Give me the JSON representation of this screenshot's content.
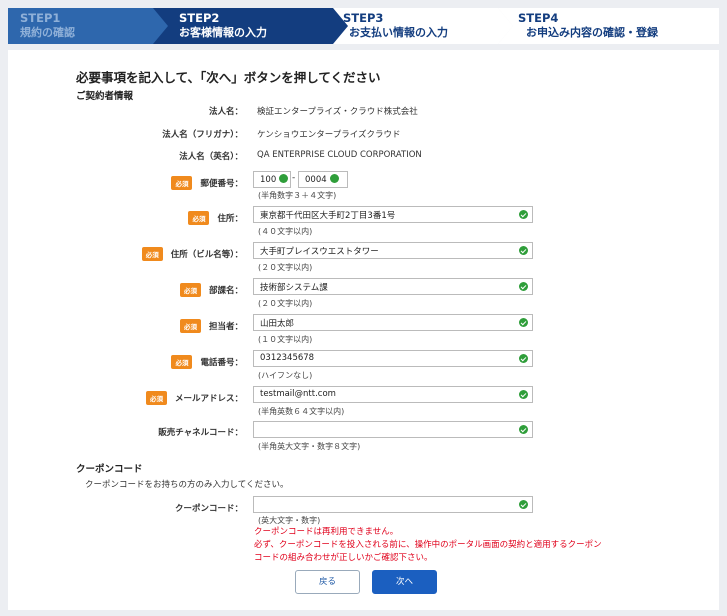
{
  "steps": [
    {
      "num": "STEP1",
      "label": "規約の確認"
    },
    {
      "num": "STEP2",
      "label": "お客様情報の入力"
    },
    {
      "num": "STEP3",
      "label": "お支払い情報の入力"
    },
    {
      "num": "STEP4",
      "label": "お申込み内容の確認・登録"
    }
  ],
  "heading": "必要事項を記入して、「次へ」ボタンを押してください",
  "contract_section": "ご契約者情報",
  "required_badge": "必須",
  "company": {
    "name_label": "法人名：",
    "name_value": "検証エンタープライズ・クラウド株式会社",
    "kana_label": "法人名（フリガナ）：",
    "kana_value": "ケンショウエンタープライズクラウド",
    "english_label": "法人名（英名）：",
    "english_value": "QA ENTERPRISE CLOUD CORPORATION"
  },
  "postal": {
    "label": "郵便番号：",
    "value1": "100",
    "separator": "-",
    "value2": "0004",
    "note": "(半角数字３＋４文字)"
  },
  "address": {
    "label": "住所：",
    "value": "東京都千代田区大手町2丁目3番1号",
    "note": "(４０文字以内)"
  },
  "building": {
    "label": "住所（ビル名等）：",
    "value": "大手町プレイスウエストタワー",
    "note": "(２０文字以内)"
  },
  "department": {
    "label": "部課名：",
    "value": "技術部システム課",
    "note": "(２０文字以内)"
  },
  "person": {
    "label": "担当者：",
    "value": "山田太郎",
    "note": "(１０文字以内)"
  },
  "phone": {
    "label": "電話番号：",
    "value": "0312345678",
    "note": "(ハイフンなし)"
  },
  "email": {
    "label": "メールアドレス：",
    "value": "testmail@ntt.com",
    "note": "(半角英数６４文字以内)"
  },
  "channel": {
    "label": "販売チャネルコード：",
    "value": "",
    "note": "(半角英大文字・数字８文字)"
  },
  "coupon_section": "クーポンコード",
  "coupon_intro": "クーポンコードをお持ちの方のみ入力してください。",
  "coupon": {
    "label": "クーポンコード：",
    "value": "",
    "note": "(英大文字・数字)",
    "warning_1": "クーポンコードは再利用できません。",
    "warning_2": "必ず、クーポンコードを投入される前に、操作中のポータル画面の契約と適用するクーポン",
    "warning_3": "コードの組み合わせが正しいかご確認下さい。"
  },
  "buttons": {
    "back": "戻る",
    "next": "次へ"
  },
  "colors": {
    "step_active": "#133d7f",
    "step_done": "#2e67ad",
    "required": "#f08a1d",
    "valid_check": "#2f9e3a",
    "warning": "#e0001b",
    "primary_button": "#1b5fc0"
  }
}
